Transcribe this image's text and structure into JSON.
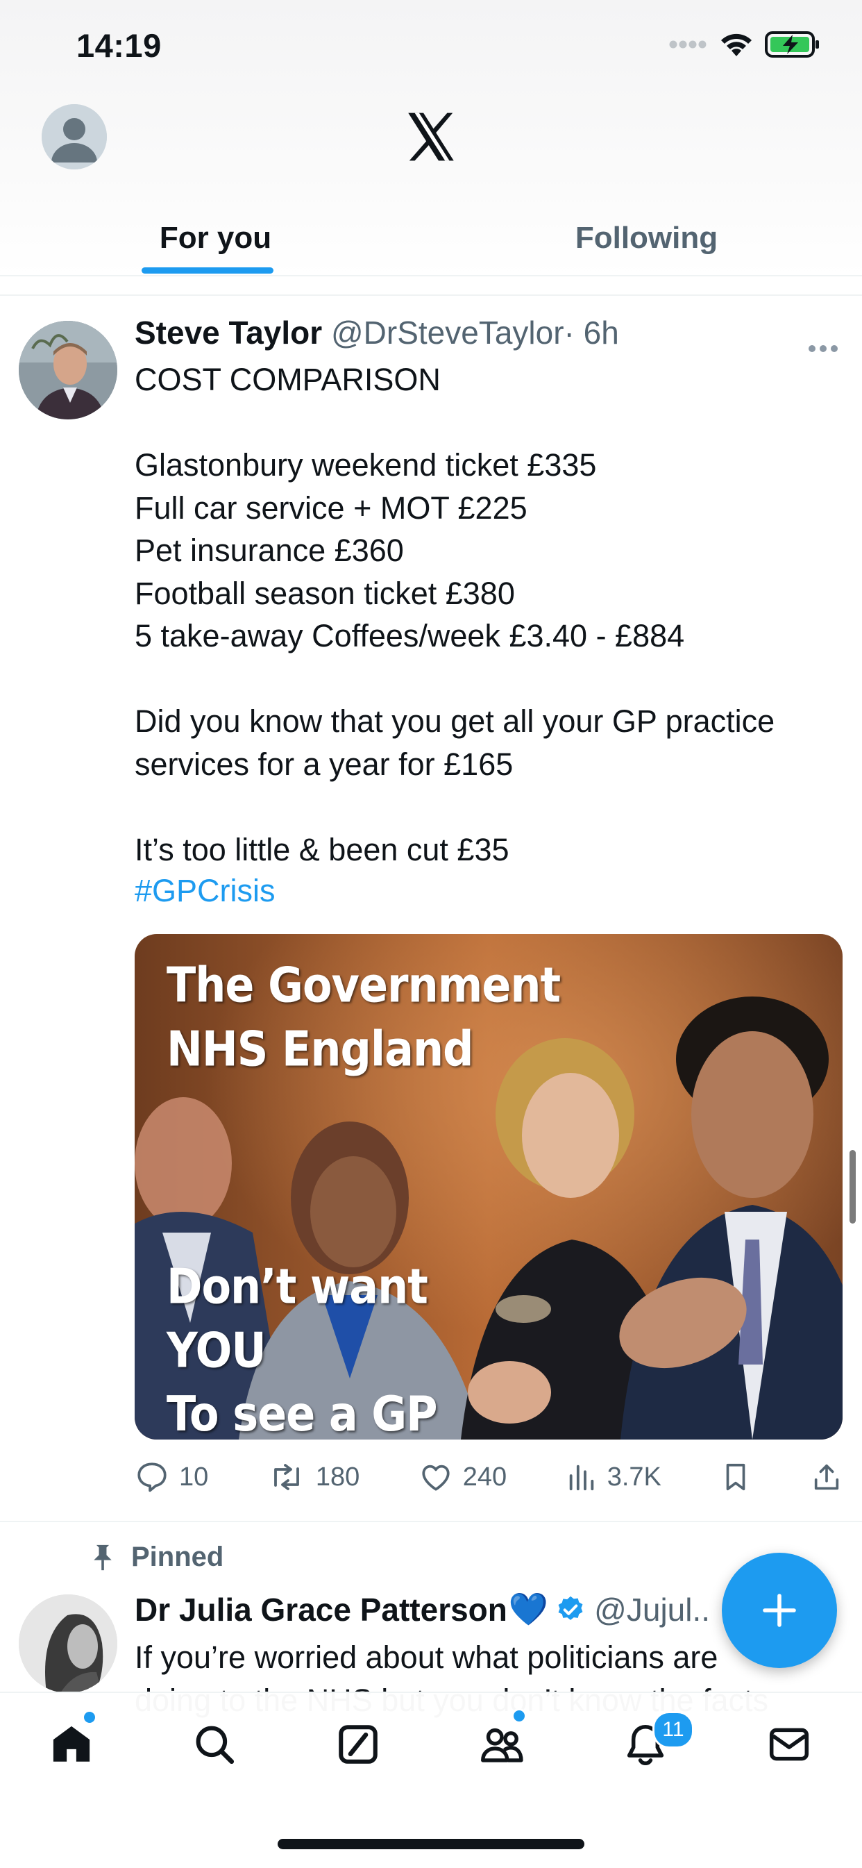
{
  "status_bar": {
    "time": "14:19"
  },
  "header": {
    "tabs": [
      {
        "label": "For you",
        "active": true
      },
      {
        "label": "Following",
        "active": false
      }
    ]
  },
  "tweet": {
    "author_name": "Steve Taylor",
    "handle": "@DrSteveTaylor",
    "time": "· 6h",
    "text": "COST COMPARISON\n\nGlastonbury weekend ticket £335\nFull car service + MOT £225\nPet insurance £360\nFootball season ticket £380\n5 take-away Coffees/week £3.40 - £884\n\nDid you know that you get all your GP practice services for a year for £165\n\nIt’s too little & been cut £35",
    "hashtag": "#GPCrisis",
    "image_text_top": [
      "The Government",
      "NHS England"
    ],
    "image_text_bottom": [
      "Don’t want",
      "YOU",
      "To see a GP"
    ],
    "replies": "10",
    "reposts": "180",
    "likes": "240",
    "views": "3.7K"
  },
  "tweet2": {
    "pinned_label": "Pinned",
    "author_name": "Dr Julia Grace Patterson",
    "emoji": "💙",
    "handle": "@Jujul..",
    "text": "If you’re worried about what politicians are\ndoing to the NHS but you don’t know the facts"
  },
  "bottom_nav": {
    "notifications_badge": "11"
  },
  "icons": [
    "profile-avatar-icon",
    "x-logo-icon",
    "more-icon",
    "reply-icon",
    "repost-icon",
    "like-icon",
    "views-icon",
    "bookmark-icon",
    "share-icon",
    "pin-icon",
    "verified-icon",
    "compose-plus-icon",
    "home-icon",
    "search-icon",
    "grok-icon",
    "communities-icon",
    "notifications-icon",
    "messages-icon"
  ],
  "colors": {
    "accent": "#1d9bf0",
    "text": "#0f1419",
    "secondary": "#536471"
  }
}
